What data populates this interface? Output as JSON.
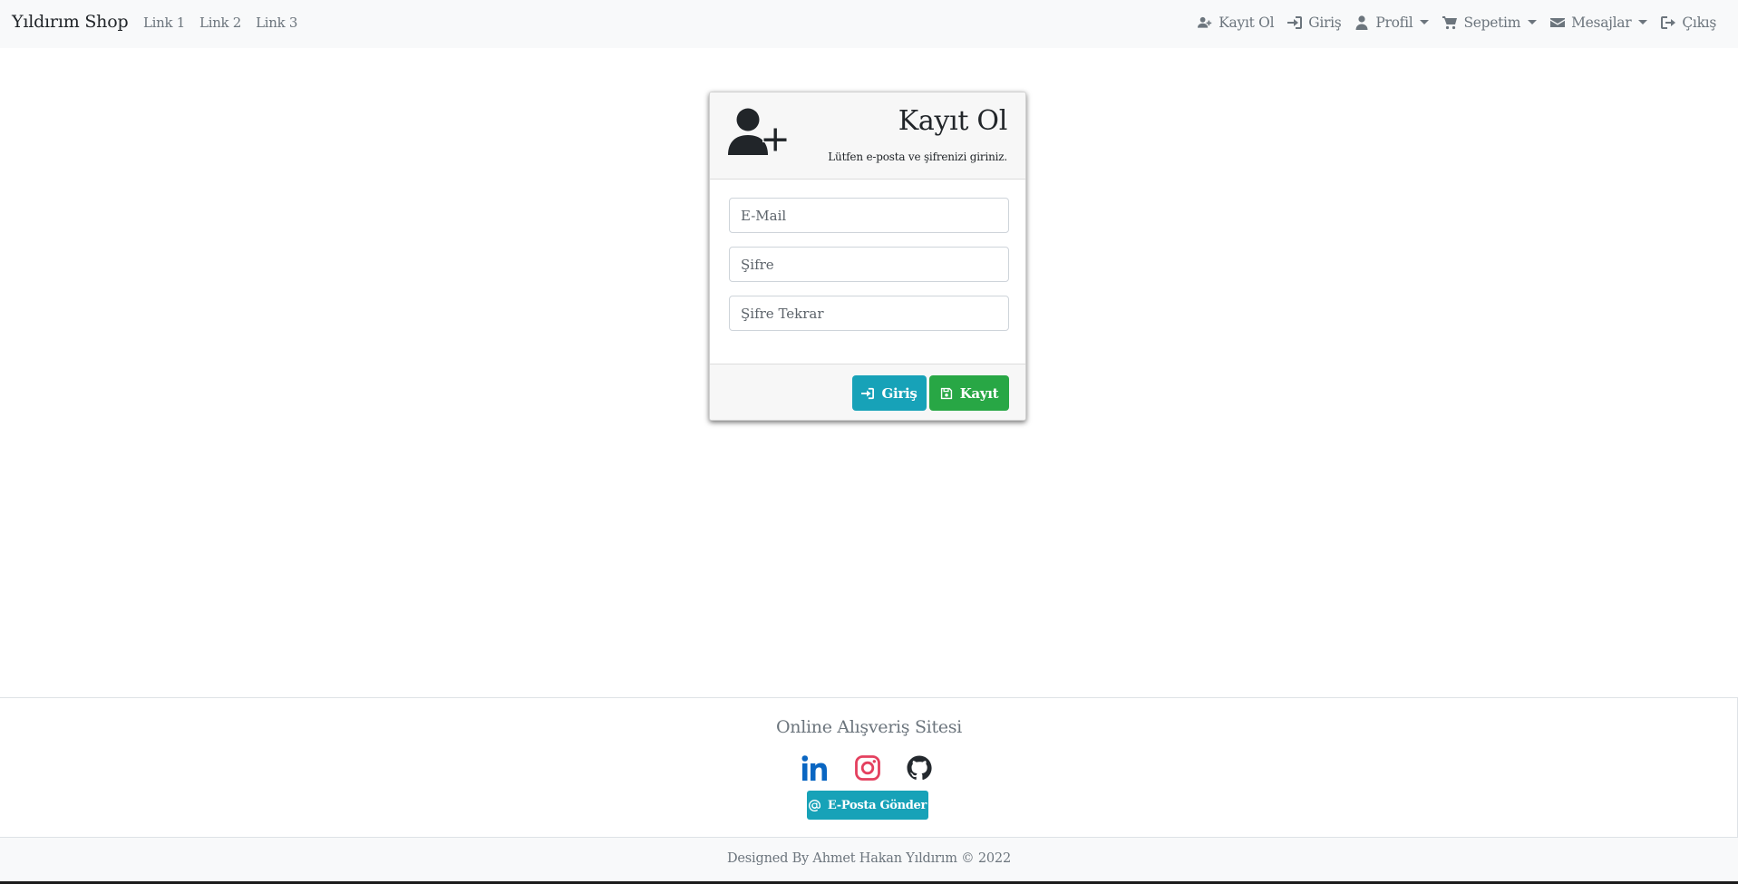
{
  "navbar": {
    "brand": "Yıldırım Shop",
    "links": [
      "Link 1",
      "Link 2",
      "Link 3"
    ],
    "right_items": {
      "register": "Kayıt Ol",
      "login": "Giriş",
      "profile": "Profil",
      "cart": "Sepetim",
      "messages": "Mesajlar",
      "logout": "Çıkış"
    }
  },
  "register_card": {
    "title": "Kayıt Ol",
    "subtitle": "Lütfen e-posta ve şifrenizi giriniz.",
    "email_placeholder": "E-Mail",
    "password_placeholder": "Şifre",
    "password_repeat_placeholder": "Şifre Tekrar",
    "login_button": "Giriş",
    "save_button": "Kayıt"
  },
  "footer": {
    "title": "Online Alışveriş Sitesi",
    "email_button": "E-Posta Gönder",
    "copyright": "Designed By Ahmet Hakan Yıldırım © 2022"
  },
  "colors": {
    "info": "#17a2b8",
    "success": "#28a745",
    "linkedin": "#0a66c2",
    "instagram": "#e4405f",
    "github": "#24292e",
    "navbar_bg": "#f8f9fa"
  },
  "icons": {
    "register": "user-plus-icon",
    "login": "sign-in-icon",
    "profile": "user-icon",
    "cart": "shopping-cart-icon",
    "messages": "envelope-icon",
    "logout": "sign-out-icon",
    "save": "floppy-disk-icon",
    "email": "at-icon",
    "linkedin": "linkedin-icon",
    "instagram": "instagram-icon",
    "github": "github-icon"
  }
}
